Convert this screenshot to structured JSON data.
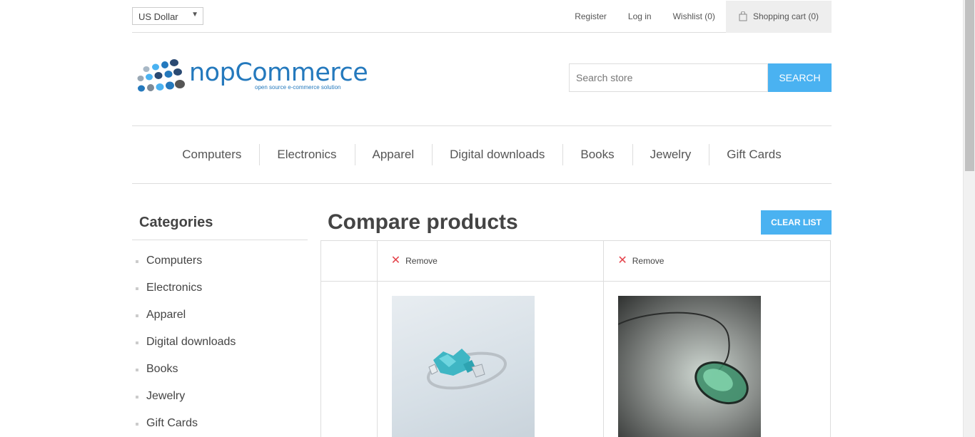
{
  "header": {
    "currency": "US Dollar",
    "links": {
      "register": "Register",
      "login": "Log in",
      "wishlist": "Wishlist (0)",
      "cart": "Shopping cart (0)"
    }
  },
  "logo": {
    "wordmark": "nopCommerce",
    "tagline": "open source e-commerce solution"
  },
  "search": {
    "placeholder": "Search store",
    "button": "SEARCH"
  },
  "top_menu": [
    "Computers",
    "Electronics",
    "Apparel",
    "Digital downloads",
    "Books",
    "Jewelry",
    "Gift Cards"
  ],
  "categories": {
    "title": "Categories",
    "items": [
      "Computers",
      "Electronics",
      "Apparel",
      "Digital downloads",
      "Books",
      "Jewelry",
      "Gift Cards"
    ]
  },
  "compare": {
    "title": "Compare products",
    "clear_button": "CLEAR LIST",
    "remove_label": "Remove"
  },
  "colors": {
    "accent": "#4ab2f1",
    "remove_x": "#e4434b",
    "logo_blue": "#2479bd"
  },
  "icons": {
    "cart": "shopping-bag-icon",
    "remove": "close-icon"
  }
}
